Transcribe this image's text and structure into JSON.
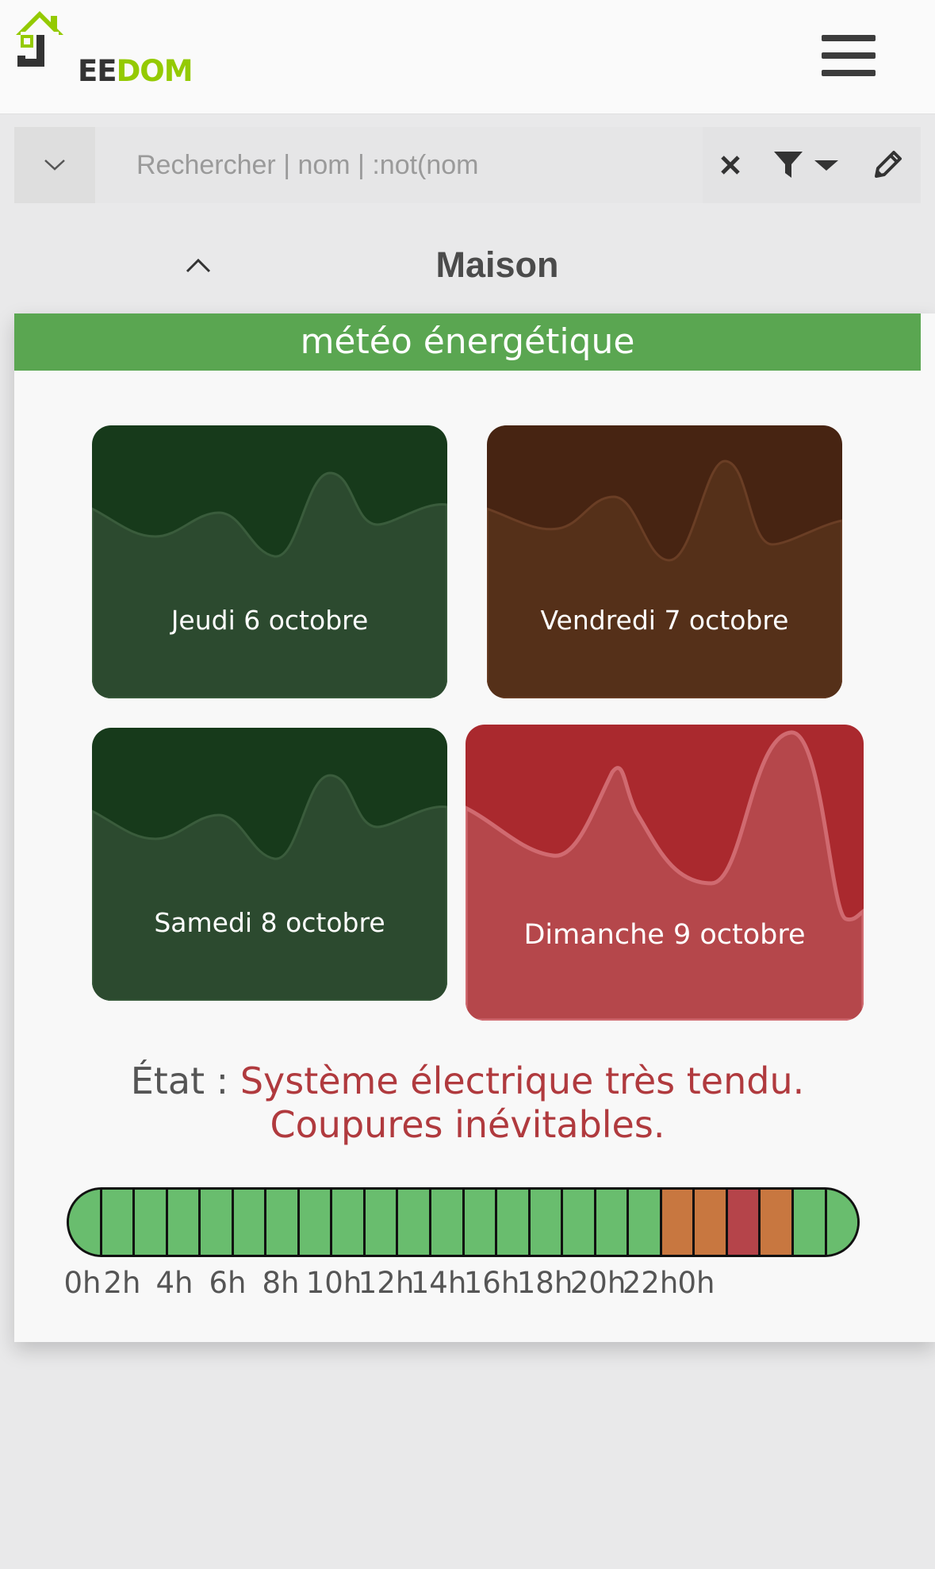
{
  "app": {
    "logo_text_ee": "EE",
    "logo_text_dom": "DOM",
    "logo_text_j": "J"
  },
  "search": {
    "placeholder": "Rechercher | nom | :not(nom",
    "value": ""
  },
  "object": {
    "title": "Maison"
  },
  "widget": {
    "title": "météo énergétique",
    "days": [
      {
        "label": "Jeudi 6 octobre",
        "level": "green",
        "bg": "#173a1b",
        "fg": "#2c4a2f",
        "stroke": "#3a5c3c"
      },
      {
        "label": "Vendredi 7 octobre",
        "level": "green",
        "bg": "#472412",
        "fg": "#553019",
        "stroke": "#6a3e25"
      },
      {
        "label": "Samedi 8 octobre",
        "level": "green",
        "bg": "#173a1b",
        "fg": "#2c4a2f",
        "stroke": "#3a5c3c"
      },
      {
        "label": "Dimanche 9 octobre",
        "level": "red",
        "bg": "#aa292e",
        "fg": "#b5474b",
        "stroke": "#d06a70"
      }
    ],
    "state_label": "État :",
    "state_value_line1": "Système électrique très tendu.",
    "state_value_line2": "Coupures inévitables.",
    "hourly_levels": [
      "green",
      "green",
      "green",
      "green",
      "green",
      "green",
      "green",
      "green",
      "green",
      "green",
      "green",
      "green",
      "green",
      "green",
      "green",
      "green",
      "green",
      "green",
      "orange",
      "orange",
      "red",
      "orange",
      "green",
      "green"
    ],
    "level_colors": {
      "green": "#69bd6e",
      "orange": "#c87740",
      "red": "#b5444a"
    },
    "hour_labels": [
      "0h",
      "2h",
      "4h",
      "6h",
      "8h",
      "10h",
      "12h",
      "14h",
      "16h",
      "18h",
      "20h",
      "22h",
      "0h"
    ]
  }
}
